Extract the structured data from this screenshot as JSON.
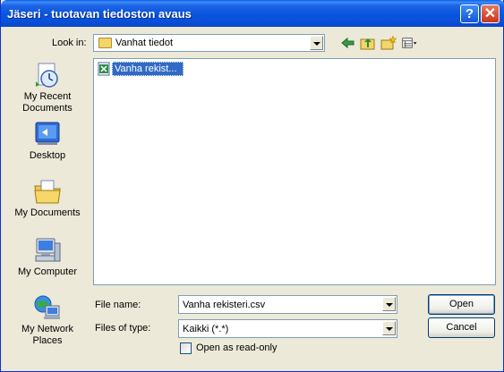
{
  "window": {
    "title": "Jäseri - tuotavan tiedoston avaus",
    "help_label": "?",
    "close_label": "✕"
  },
  "lookin": {
    "label": "Look in:",
    "value": "Vanhat tiedot"
  },
  "toolbar": {
    "icons": [
      "back-icon",
      "up-one-level-icon",
      "new-folder-icon",
      "views-menu-icon"
    ]
  },
  "places": {
    "recent": "My Recent Documents",
    "desktop": "Desktop",
    "documents": "My Documents",
    "computer": "My Computer",
    "network": "My Network Places"
  },
  "file_list": {
    "items": [
      {
        "name": "Vanha rekist...",
        "icon": "csv-file-icon",
        "selected": true
      }
    ]
  },
  "filename": {
    "label": "File name:",
    "value": "Vanha rekisteri.csv"
  },
  "filetype": {
    "label": "Files of type:",
    "value": "Kaikki (*.*)"
  },
  "buttons": {
    "open": "Open",
    "cancel": "Cancel"
  },
  "readonly": {
    "label": "Open as read-only",
    "checked": false
  },
  "colors": {
    "titlebar": "#0A4ED6",
    "dialog_bg": "#ECE9D8",
    "selection": "#316AC5"
  }
}
